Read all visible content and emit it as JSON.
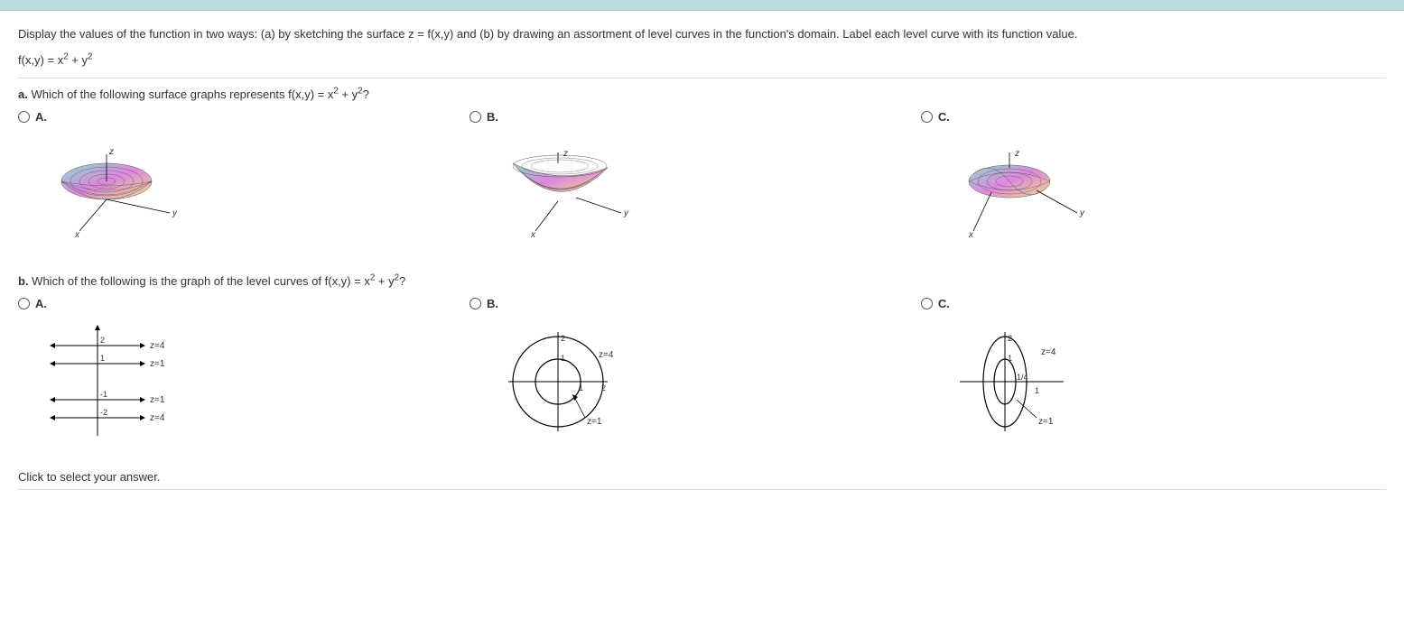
{
  "intro": {
    "line1": "Display the values of the function in two ways: (a) by sketching the surface z = f(x,y) and (b) by drawing an assortment of level curves in the function's domain. Label each level curve with its function value.",
    "formula_html": "f(x,y) = x² + y²"
  },
  "partA": {
    "prompt_html": "a. Which of the following surface graphs represents f(x,y) = x² + y²?",
    "options": [
      {
        "label": "A."
      },
      {
        "label": "B."
      },
      {
        "label": "C."
      }
    ],
    "axis_labels": {
      "x": "x",
      "y": "y",
      "z": "z"
    }
  },
  "partB": {
    "prompt_html": "b. Which of the following is the graph of the level curves of f(x,y) = x² + y²?",
    "options": [
      {
        "label": "A."
      },
      {
        "label": "B."
      },
      {
        "label": "C."
      }
    ],
    "curveA": {
      "ticks": [
        "2",
        "1",
        "-1",
        "-2"
      ],
      "labels": [
        "z=4",
        "z=1",
        "z=1",
        "z=4"
      ]
    },
    "curveB": {
      "yticks": [
        "2",
        "1"
      ],
      "xticks": [
        "1",
        "2"
      ],
      "labels": [
        "z=4",
        "z=1"
      ]
    },
    "curveC": {
      "yticks": [
        "2",
        "1"
      ],
      "centerlabel": "1/4",
      "xtick": "1",
      "labels": [
        "z=4",
        "z=1"
      ]
    }
  },
  "footer": "Click to select your answer."
}
